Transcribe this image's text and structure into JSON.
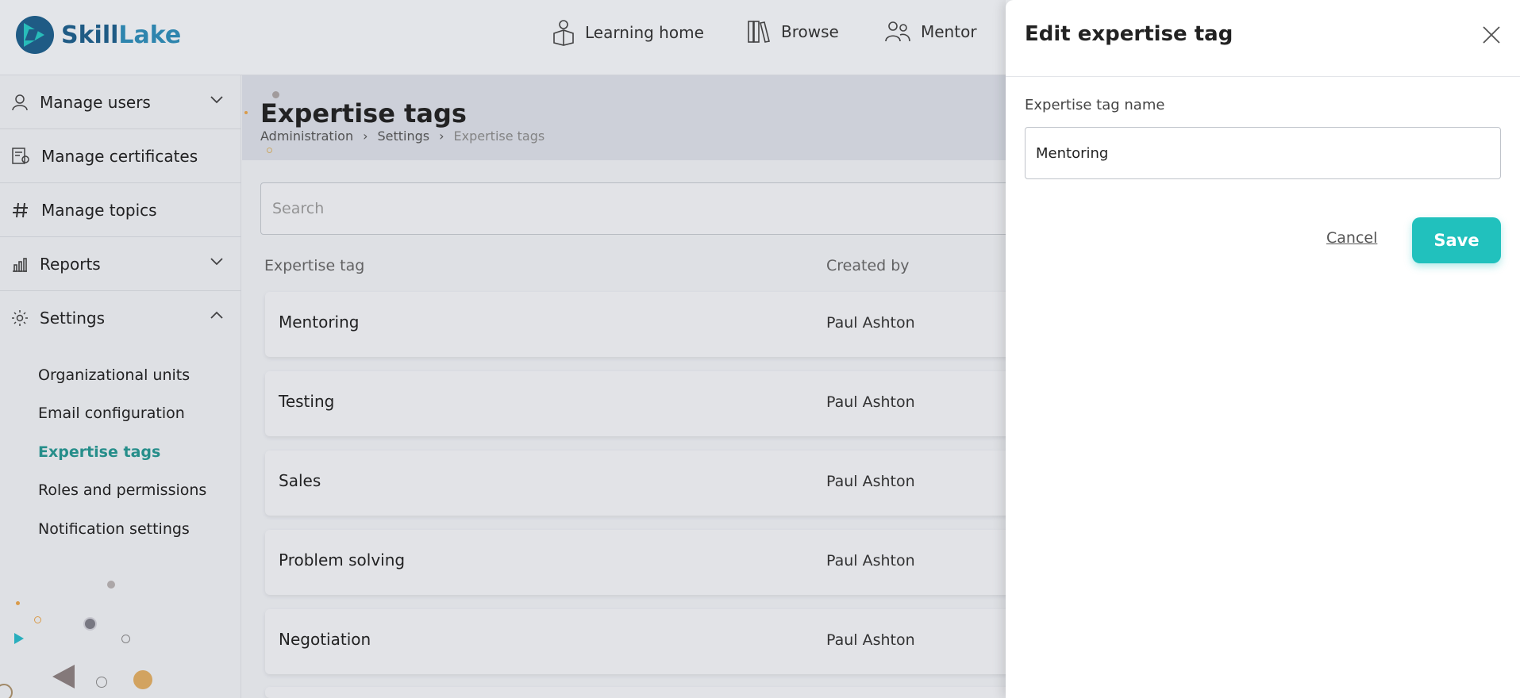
{
  "brand": {
    "name_part1": "Skill",
    "name_part2": "Lake"
  },
  "topnav": [
    {
      "label": "Learning home",
      "icon": "learning-home-icon"
    },
    {
      "label": "Browse",
      "icon": "browse-icon"
    },
    {
      "label": "Mentor",
      "icon": "mentor-icon"
    }
  ],
  "sidebar": {
    "items": [
      {
        "label": "Manage users",
        "icon": "user-icon",
        "expanded": false
      },
      {
        "label": "Manage certificates",
        "icon": "certificate-icon"
      },
      {
        "label": "Manage topics",
        "icon": "hash-icon"
      },
      {
        "label": "Reports",
        "icon": "reports-icon",
        "expanded": false
      },
      {
        "label": "Settings",
        "icon": "gear-icon",
        "expanded": true
      }
    ],
    "settings_sub": [
      {
        "label": "Organizational units",
        "active": false
      },
      {
        "label": "Email configuration",
        "active": false
      },
      {
        "label": "Expertise tags",
        "active": true
      },
      {
        "label": "Roles and permissions",
        "active": false
      },
      {
        "label": "Notification settings",
        "active": false
      }
    ]
  },
  "page": {
    "title": "Expertise tags",
    "breadcrumbs": [
      "Administration",
      "Settings",
      "Expertise tags"
    ],
    "search_placeholder": "Search",
    "columns": [
      "Expertise tag",
      "Created by"
    ],
    "rows": [
      {
        "tag": "Mentoring",
        "created_by": "Paul Ashton"
      },
      {
        "tag": "Testing",
        "created_by": "Paul Ashton"
      },
      {
        "tag": "Sales",
        "created_by": "Paul Ashton"
      },
      {
        "tag": "Problem solving",
        "created_by": "Paul Ashton"
      },
      {
        "tag": "Negotiation",
        "created_by": "Paul Ashton"
      }
    ]
  },
  "drawer": {
    "title": "Edit expertise tag",
    "field_label": "Expertise tag name",
    "field_value": "Mentoring",
    "cancel_label": "Cancel",
    "save_label": "Save"
  },
  "colors": {
    "accent": "#21c1bd",
    "active_link": "#26948f",
    "brand_blue": "#1f5e8a"
  }
}
